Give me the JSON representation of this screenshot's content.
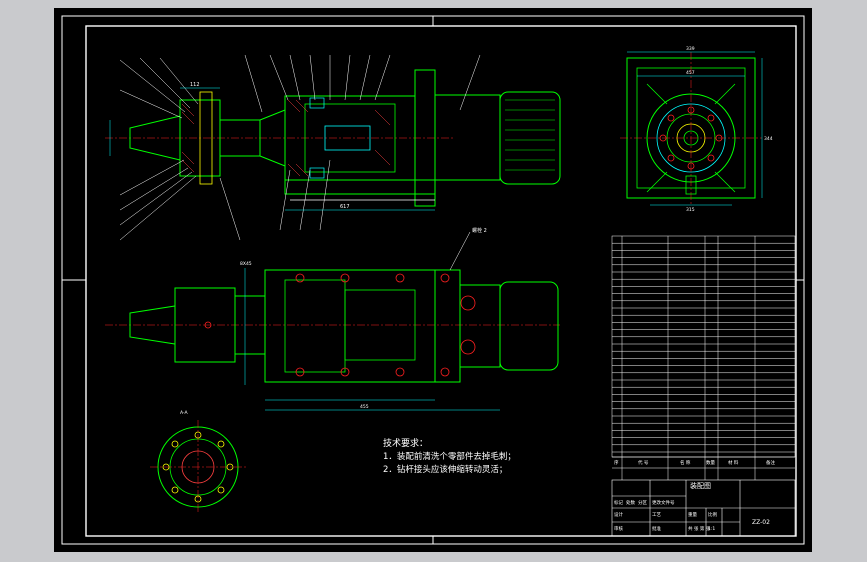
{
  "drawing": {
    "title": "装配图",
    "drawing_no": "ZZ-02",
    "dimensions": {
      "front_total_length": "617",
      "plan_length": "455",
      "side_top_width": "339",
      "side_width_2": "457",
      "side_height": "344",
      "side_bottom": "315",
      "front_dim_small": "112",
      "top_label": "8X45"
    },
    "tech_requirements": {
      "heading": "技术要求：",
      "items": [
        "1．装配前清洗个零部件去掉毛刺；",
        "2．钻杆接头应该伸缩转动灵活；"
      ]
    },
    "view_labels": {
      "section_a": "A-A",
      "plan_note": "螺栓 2"
    },
    "title_block": {
      "header_seq": "序",
      "header_code": "代  号",
      "header_name": "名  称",
      "header_qty": "数量",
      "header_material": "材  料",
      "header_note": "备注",
      "drawing_name": "装配图",
      "row_labels": [
        "标记",
        "处数",
        "分区",
        "更改文件号",
        "签名",
        "年月日"
      ],
      "design_label": "设计",
      "check_label": "审核",
      "process_label": "工艺",
      "approve_label": "批准",
      "scale_label": "比例",
      "scale": "1:1",
      "weight_label": "重量",
      "sheet_label": "共 张 第 张"
    },
    "colors": {
      "background": "#000000",
      "frame": "#ffffff",
      "part": "#00ff00",
      "leader": "#ffffff",
      "dimension": "#00ffff",
      "hatch": "#ff4040",
      "yellow": "#ffff00",
      "red": "#ff2020",
      "magenta": "#ff00ff"
    }
  }
}
